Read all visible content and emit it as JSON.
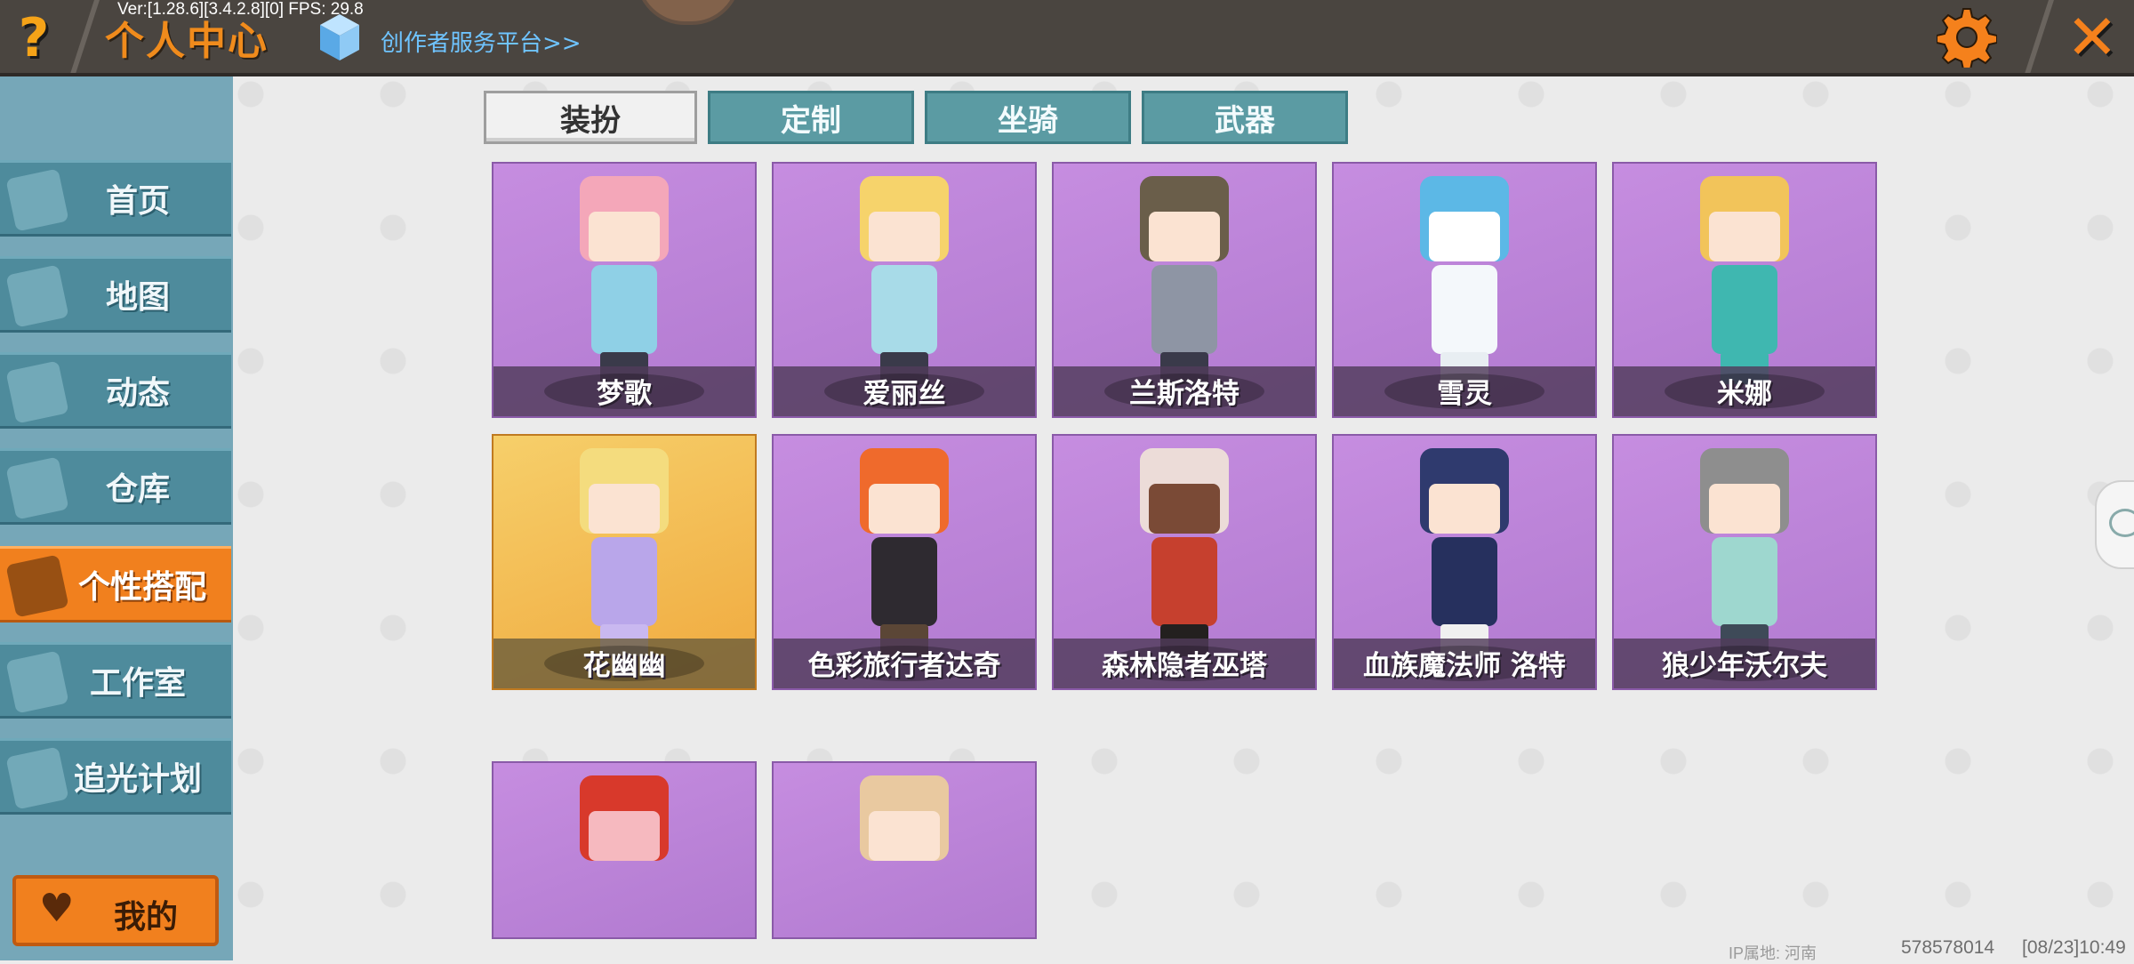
{
  "topbar": {
    "title": "个人中心",
    "version": "Ver:[1.28.6][3.4.2.8][0] FPS: 29.8",
    "creator_link": "创作者服务平台>>",
    "help_glyph": "?",
    "close_glyph": "✕"
  },
  "sidebar": {
    "items": [
      {
        "label": "首页",
        "icon": "house-icon"
      },
      {
        "label": "地图",
        "icon": "map-icon"
      },
      {
        "label": "动态",
        "icon": "bell-icon"
      },
      {
        "label": "仓库",
        "icon": "warehouse-icon"
      },
      {
        "label": "个性搭配",
        "icon": "outfit-icon",
        "active": true
      },
      {
        "label": "工作室",
        "icon": "studio-icon"
      },
      {
        "label": "追光计划",
        "icon": "lightchase-icon"
      }
    ],
    "mine_label": "我的",
    "mine_icon": "heart-icon"
  },
  "tabs": [
    {
      "label": "装扮",
      "active": true
    },
    {
      "label": "定制"
    },
    {
      "label": "坐骑"
    },
    {
      "label": "武器"
    }
  ],
  "skins": [
    {
      "name": "梦歌"
    },
    {
      "name": "爱丽丝"
    },
    {
      "name": "兰斯洛特"
    },
    {
      "name": "雪灵"
    },
    {
      "name": "米娜"
    },
    {
      "name": "花幽幽",
      "highlight": true
    },
    {
      "name": "色彩旅行者达奇"
    },
    {
      "name": "森林隐者巫塔"
    },
    {
      "name": "血族魔法师 洛特"
    },
    {
      "name": "狼少年沃尔夫"
    },
    {
      "name": ""
    },
    {
      "name": ""
    }
  ],
  "footer": {
    "ip_location": "IP属地: 河南",
    "user_id": "578578014",
    "timestamp": "[08/23]10:49"
  },
  "colors": {
    "accent": "#f1801e",
    "sidebar": "#4e8b9c",
    "tab": "#5b9ba3",
    "card": "#c68de0"
  }
}
